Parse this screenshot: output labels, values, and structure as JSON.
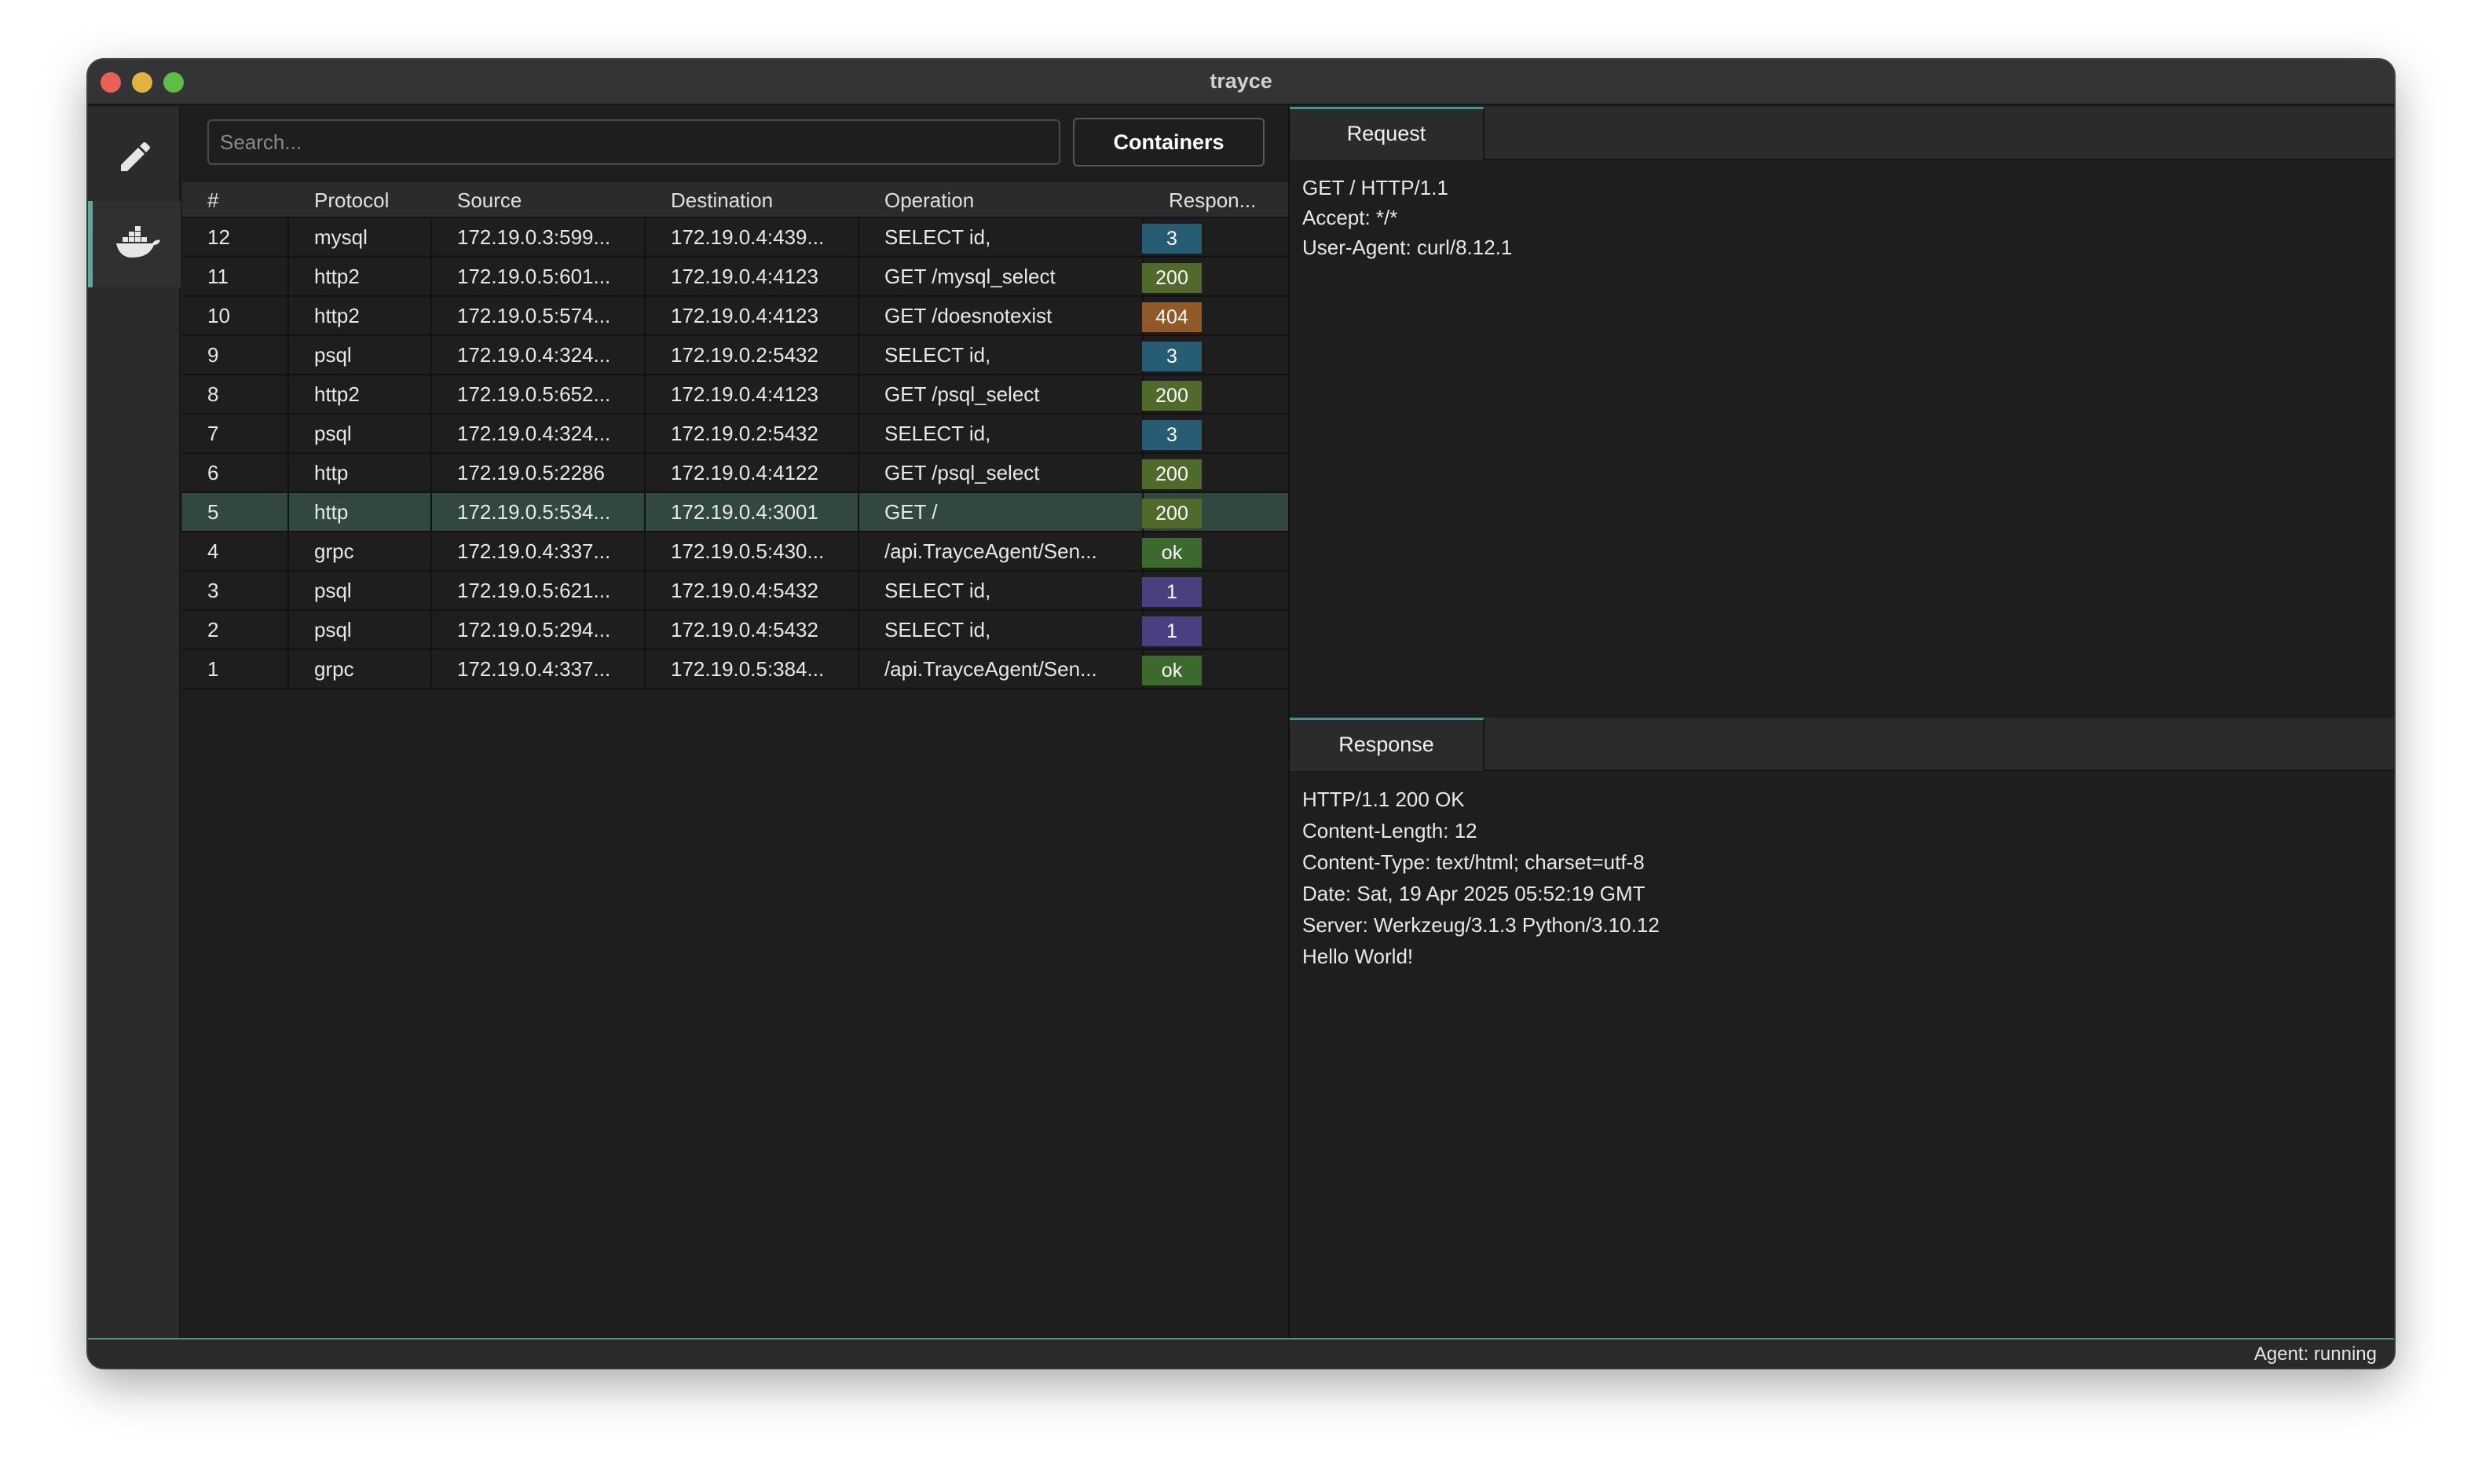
{
  "window": {
    "title": "trayce"
  },
  "sidebar": {
    "items": [
      {
        "icon": "pencil-icon"
      },
      {
        "icon": "docker-icon",
        "active": true
      }
    ]
  },
  "search": {
    "placeholder": "Search...",
    "value": ""
  },
  "toolbar": {
    "containers_label": "Containers"
  },
  "table": {
    "columns": [
      "#",
      "Protocol",
      "Source",
      "Destination",
      "Operation",
      "Respon..."
    ],
    "rows": [
      {
        "num": "12",
        "protocol": "mysql",
        "source": "172.19.0.3:599...",
        "destination": "172.19.0.4:439...",
        "operation": "SELECT id,",
        "response": "3",
        "color": "#265d75"
      },
      {
        "num": "11",
        "protocol": "http2",
        "source": "172.19.0.5:601...",
        "destination": "172.19.0.4:4123",
        "operation": "GET /mysql_select",
        "response": "200",
        "color": "#4f6a2a"
      },
      {
        "num": "10",
        "protocol": "http2",
        "source": "172.19.0.5:574...",
        "destination": "172.19.0.4:4123",
        "operation": "GET /doesnotexist",
        "response": "404",
        "color": "#8f5a26"
      },
      {
        "num": "9",
        "protocol": "psql",
        "source": "172.19.0.4:324...",
        "destination": "172.19.0.2:5432",
        "operation": "SELECT id,",
        "response": "3",
        "color": "#265d75"
      },
      {
        "num": "8",
        "protocol": "http2",
        "source": "172.19.0.5:652...",
        "destination": "172.19.0.4:4123",
        "operation": "GET /psql_select",
        "response": "200",
        "color": "#4f6a2a"
      },
      {
        "num": "7",
        "protocol": "psql",
        "source": "172.19.0.4:324...",
        "destination": "172.19.0.2:5432",
        "operation": "SELECT id,",
        "response": "3",
        "color": "#265d75"
      },
      {
        "num": "6",
        "protocol": "http",
        "source": "172.19.0.5:2286",
        "destination": "172.19.0.4:4122",
        "operation": "GET /psql_select",
        "response": "200",
        "color": "#4f6a2a"
      },
      {
        "num": "5",
        "protocol": "http",
        "source": "172.19.0.5:534...",
        "destination": "172.19.0.4:3001",
        "operation": "GET /",
        "response": "200",
        "color": "#4f6a2a",
        "selected": true
      },
      {
        "num": "4",
        "protocol": "grpc",
        "source": "172.19.0.4:337...",
        "destination": "172.19.0.5:430...",
        "operation": "/api.TrayceAgent/Sen...",
        "response": "ok",
        "color": "#3c6a2c"
      },
      {
        "num": "3",
        "protocol": "psql",
        "source": "172.19.0.5:621...",
        "destination": "172.19.0.4:5432",
        "operation": "SELECT id,",
        "response": "1",
        "color": "#4a3f7f"
      },
      {
        "num": "2",
        "protocol": "psql",
        "source": "172.19.0.5:294...",
        "destination": "172.19.0.4:5432",
        "operation": "SELECT id,",
        "response": "1",
        "color": "#4a3f7f"
      },
      {
        "num": "1",
        "protocol": "grpc",
        "source": "172.19.0.4:337...",
        "destination": "172.19.0.5:384...",
        "operation": "/api.TrayceAgent/Sen...",
        "response": "ok",
        "color": "#3c6a2c"
      }
    ]
  },
  "request": {
    "tab_label": "Request",
    "lines": [
      "GET / HTTP/1.1",
      "Accept: */*",
      "User-Agent: curl/8.12.1"
    ]
  },
  "response": {
    "tab_label": "Response",
    "lines": [
      "HTTP/1.1 200 OK",
      "Content-Length: 12",
      "Content-Type: text/html; charset=utf-8",
      "Date: Sat, 19 Apr 2025 05:52:19 GMT",
      "Server: Werkzeug/3.1.3 Python/3.10.12",
      "Hello World!"
    ]
  },
  "status": {
    "text": "Agent: running"
  },
  "colors": {
    "accent": "#4f8f86",
    "selected_row": "#31473f"
  }
}
